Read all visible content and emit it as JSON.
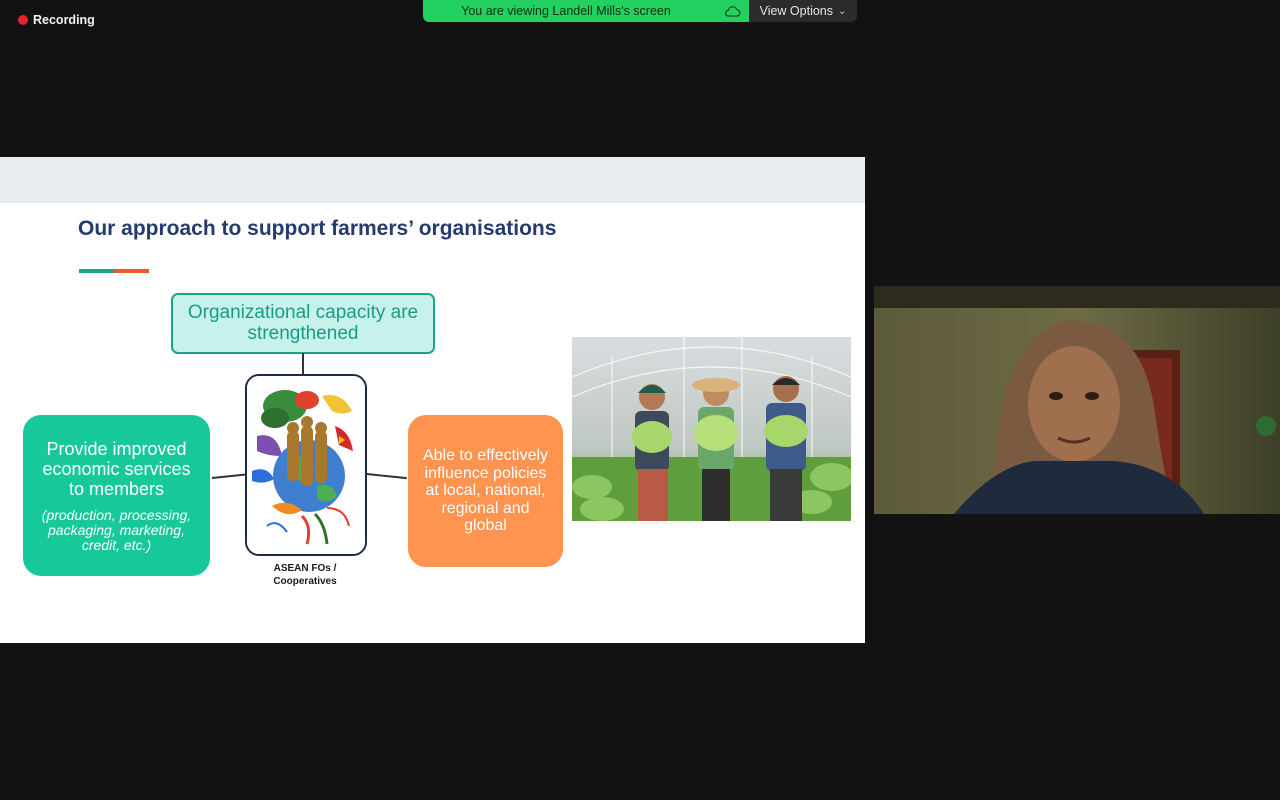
{
  "recording": {
    "label": "Recording"
  },
  "banner": {
    "viewing_text": "You are viewing Landell Mills's screen",
    "view_options_label": "View Options"
  },
  "slide": {
    "title": "Our approach to support farmers’ organisations",
    "capacity_box": {
      "line1": "Organizational capacity are",
      "line2": "strengthened"
    },
    "economic_box": {
      "line1": "Provide improved",
      "line2": "economic services",
      "line3": "to members",
      "sub1": "(production, processing,",
      "sub2": "packaging, marketing,",
      "sub3": "credit, etc.)"
    },
    "emblem_caption": {
      "line1": "ASEAN FOs /",
      "line2": "Cooperatives"
    },
    "policy_box": {
      "line1": "Able to effectively",
      "line2": "influence policies",
      "line3": "at local, national,",
      "line4": "regional and",
      "line5": "global"
    }
  },
  "colors": {
    "banner_green": "#23d160",
    "title_navy": "#253b6e",
    "teal": "#1aa58a",
    "green_box": "#17c89b",
    "orange_box": "#ff9450",
    "accent_orange": "#ee5a24",
    "recording_red": "#e0252b"
  },
  "icons": {
    "recording": "record-dot-icon",
    "cloud": "cloud-icon",
    "chevron": "chevron-down-icon"
  }
}
